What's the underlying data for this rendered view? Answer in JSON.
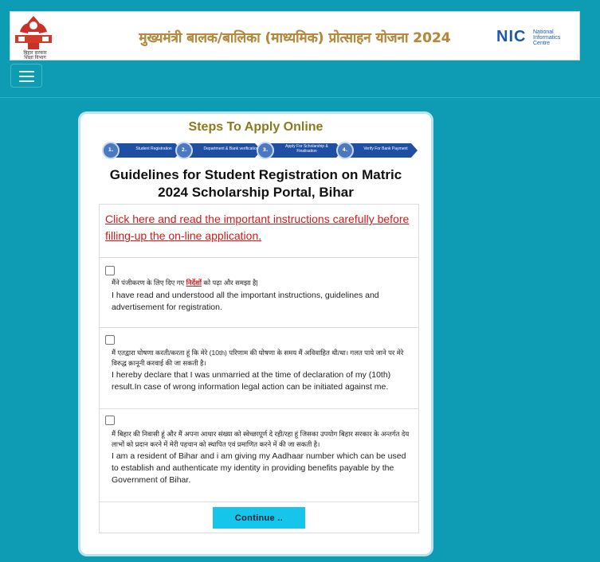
{
  "header": {
    "title": "मुख्यमंत्री बालक/बालिका (माध्यमिक) प्रोत्साहन योजना 2024",
    "emblem_caption": "बिहार सरकार\nशिक्षा विभाग",
    "nic_word": "NIC",
    "nic_sub": "National Informatics Centre"
  },
  "card": {
    "steps_title": "Steps To Apply Online",
    "steps": [
      {
        "num": "1.",
        "label": "Student Registration"
      },
      {
        "num": "2.",
        "label": "Department & Bank verification"
      },
      {
        "num": "3.",
        "label": "Apply For Scholarship & Finalisation"
      },
      {
        "num": "4.",
        "label": "Verify For Bank Payment"
      }
    ],
    "guide_title": "Guidelines for Student Registration on Matric 2024 Scholarship Portal, Bihar",
    "instructions_link": "Click here and read the important instructions carefully before filling-up the on-line application.",
    "declarations": [
      {
        "hi_before": "मैंने पंजीकरण के लिए दिए गए ",
        "hi_link": "निर्देशों",
        "hi_after": " को पढ़ा और समझा है|",
        "en": "I have read and understood all the important instructions, guidelines and advertisement for registration."
      },
      {
        "hi": "मैं एतद्वारा घोषणा करती/करता हूं कि मेरे (10th) परिणाम की घोषणा के समय मैं अविवाहित थी/था। गलत पाये जाने पर मेरे विरुद्ध क़ानूनी करवाई की जा सकती है।",
        "en": "I hereby declare that I was unmarried at the time of declaration of my (10th) result.In case of wrong information legal action can be initiated against me."
      },
      {
        "hi": "मैं बिहार की निवासी हूं और मैं अपना आधार संख्या को स्वेच्छापूर्ण दे रही/रहा हूं जिसका उपयोग बिहार सरकार के अन्तर्गत देय लाभों को प्रदान करने में मेरी पहचान को स्थापित एवं प्रमाणित करने में की जा सकती है।",
        "en": "I am a resident of Bihar and i am giving my Aadhaar number which can be used to establish and authenticate my identity in providing benefits payable by the Government of Bihar."
      }
    ],
    "continue_label": "Continue .."
  },
  "colors": {
    "background": "#0e9bb4",
    "title_gold": "#b8893a",
    "link_red": "#d11a1a",
    "button": "#15c6ea",
    "step_blue": "#1f4fa3"
  },
  "icons": [
    "bihar-emblem-icon",
    "nic-logo-icon",
    "hamburger-menu-icon"
  ]
}
